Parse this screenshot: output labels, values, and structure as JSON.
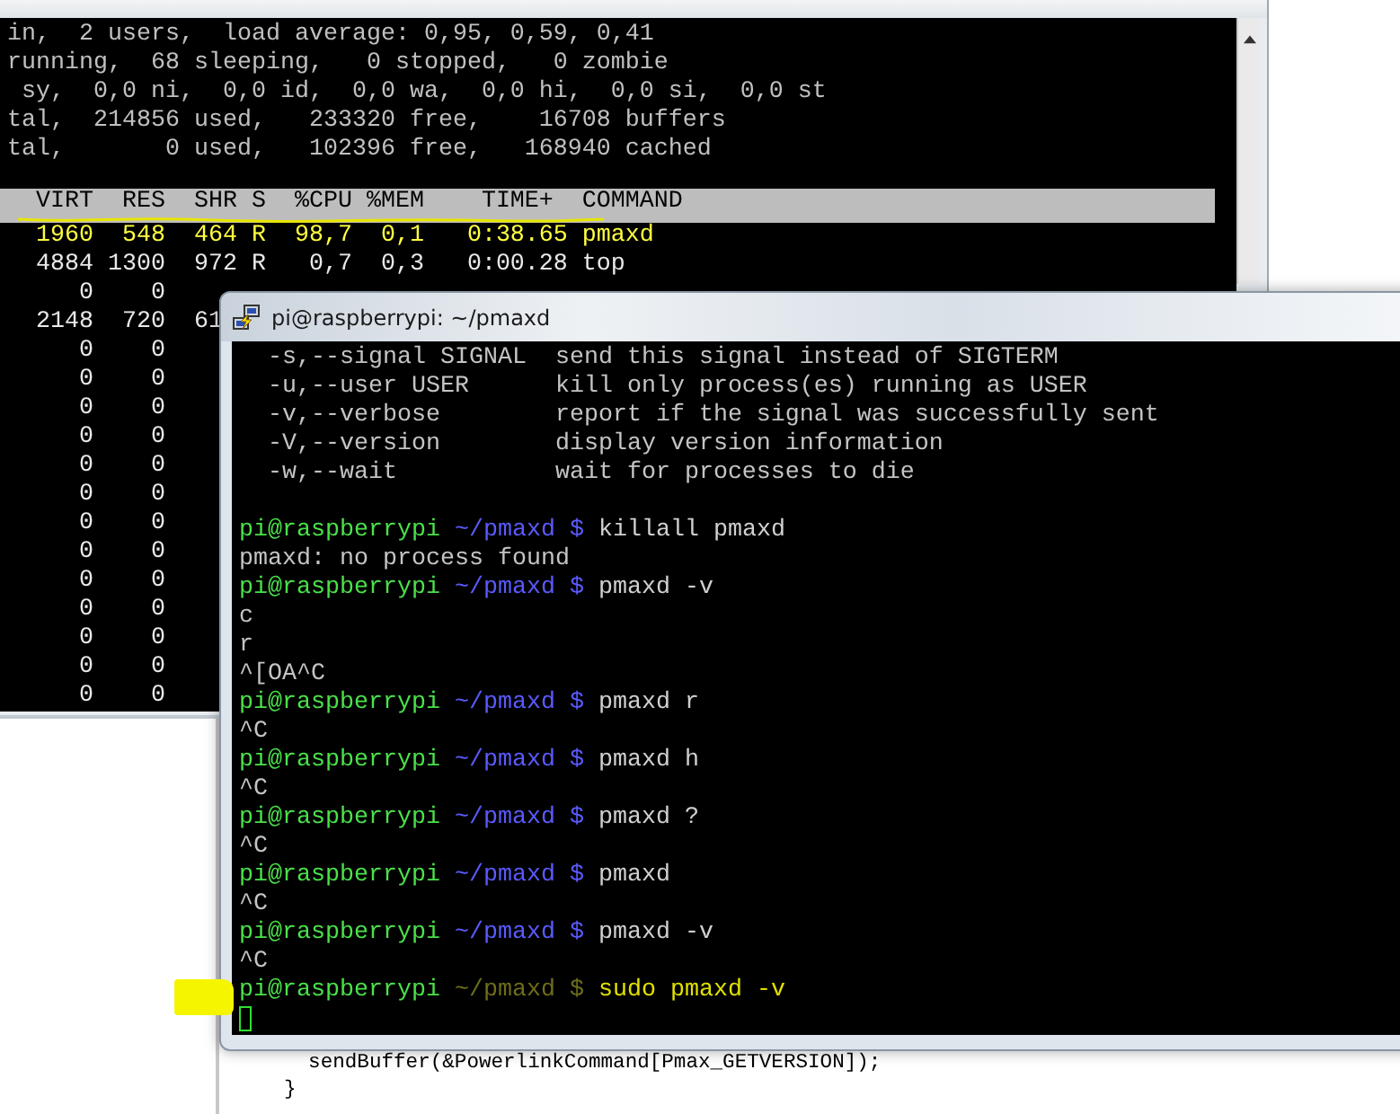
{
  "back_terminal": {
    "summary_lines": [
      "in,  2 users,  load average: 0,95, 0,59, 0,41",
      "running,  68 sleeping,   0 stopped,   0 zombie",
      " sy,  0,0 ni,  0,0 id,  0,0 wa,  0,0 hi,  0,0 si,  0,0 st",
      "tal,  214856 used,   233320 free,    16708 buffers",
      "tal,       0 used,   102396 free,   168940 cached"
    ],
    "process_header": "  VIRT  RES  SHR S  %CPU %MEM    TIME+  COMMAND",
    "processes": [
      {
        "text": "  1960  548  464 R  98,7  0,1   0:38.65 pmaxd",
        "highlighted": true
      },
      {
        "text": "  4884 1300  972 R   0,7  0,3   0:00.28 top",
        "highlighted": false
      },
      {
        "text": "     0    0",
        "highlighted": false
      },
      {
        "text": "  2148  720  61",
        "highlighted": false
      },
      {
        "text": "     0    0",
        "highlighted": false
      },
      {
        "text": "     0    0",
        "highlighted": false
      },
      {
        "text": "     0    0",
        "highlighted": false
      },
      {
        "text": "     0    0",
        "highlighted": false
      },
      {
        "text": "     0    0",
        "highlighted": false
      },
      {
        "text": "     0    0",
        "highlighted": false
      },
      {
        "text": "     0    0",
        "highlighted": false
      },
      {
        "text": "     0    0",
        "highlighted": false
      },
      {
        "text": "     0    0",
        "highlighted": false
      },
      {
        "text": "     0    0",
        "highlighted": false
      },
      {
        "text": "     0    0",
        "highlighted": false
      },
      {
        "text": "     0    0",
        "highlighted": false
      },
      {
        "text": "     0    0",
        "highlighted": false
      }
    ]
  },
  "front_terminal": {
    "title": "pi@raspberrypi: ~/pmaxd",
    "lines": [
      {
        "kind": "output",
        "text": "  -s,--signal SIGNAL  send this signal instead of SIGTERM"
      },
      {
        "kind": "output",
        "text": "  -u,--user USER      kill only process(es) running as USER"
      },
      {
        "kind": "output",
        "text": "  -v,--verbose        report if the signal was successfully sent"
      },
      {
        "kind": "output",
        "text": "  -V,--version        display version information"
      },
      {
        "kind": "output",
        "text": "  -w,--wait           wait for processes to die"
      },
      {
        "kind": "blank"
      },
      {
        "kind": "prompt",
        "user": "pi@raspberrypi",
        "path": "~/pmaxd",
        "symbol": "$",
        "command": "killall pmaxd",
        "dimmed": false
      },
      {
        "kind": "output",
        "text": "pmaxd: no process found"
      },
      {
        "kind": "prompt",
        "user": "pi@raspberrypi",
        "path": "~/pmaxd",
        "symbol": "$",
        "command": "pmaxd -v",
        "dimmed": false
      },
      {
        "kind": "output",
        "text": "c"
      },
      {
        "kind": "output",
        "text": "r"
      },
      {
        "kind": "output",
        "text": "^[OA^C"
      },
      {
        "kind": "prompt",
        "user": "pi@raspberrypi",
        "path": "~/pmaxd",
        "symbol": "$",
        "command": "pmaxd r",
        "dimmed": false
      },
      {
        "kind": "output",
        "text": "^C"
      },
      {
        "kind": "prompt",
        "user": "pi@raspberrypi",
        "path": "~/pmaxd",
        "symbol": "$",
        "command": "pmaxd h",
        "dimmed": false
      },
      {
        "kind": "output",
        "text": "^C"
      },
      {
        "kind": "prompt",
        "user": "pi@raspberrypi",
        "path": "~/pmaxd",
        "symbol": "$",
        "command": "pmaxd ?",
        "dimmed": false
      },
      {
        "kind": "output",
        "text": "^C"
      },
      {
        "kind": "prompt",
        "user": "pi@raspberrypi",
        "path": "~/pmaxd",
        "symbol": "$",
        "command": "pmaxd",
        "dimmed": false
      },
      {
        "kind": "output",
        "text": "^C"
      },
      {
        "kind": "prompt",
        "user": "pi@raspberrypi",
        "path": "~/pmaxd",
        "symbol": "$",
        "command": "pmaxd -v",
        "dimmed": false
      },
      {
        "kind": "output",
        "text": "^C"
      },
      {
        "kind": "prompt",
        "user": "pi@raspberrypi",
        "path": "~/pmaxd",
        "symbol": "$",
        "command": "sudo pmaxd -v",
        "dimmed": true
      },
      {
        "kind": "cursor"
      }
    ]
  },
  "code_editor": {
    "lines": [
      "  sendBuffer(&PowerlinkCommand[Pmax_GETVERSION]);",
      "}"
    ]
  }
}
